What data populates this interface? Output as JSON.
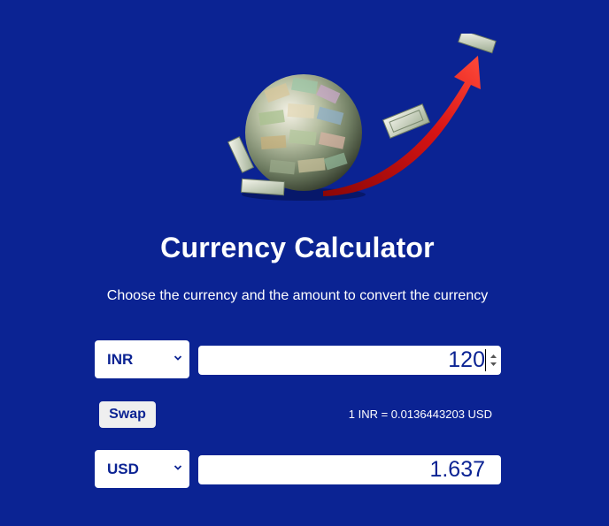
{
  "page": {
    "title": "Currency Calculator",
    "subtitle": "Choose the currency and the amount to convert the currency"
  },
  "converter": {
    "from_currency": "INR",
    "from_amount": "120",
    "swap_label": "Swap",
    "rate_text": "1 INR = 0.0136443203 USD",
    "to_currency": "USD",
    "to_amount": "1.637"
  },
  "icons": {
    "hero": "money-globe-growth-arrow-image",
    "select": "chevron-down-icon",
    "spinner": "number-spinner-icon"
  },
  "colors": {
    "background": "#0b2393",
    "text_on_background": "#ffffff",
    "field_text": "#0b2393",
    "arrow": "#d40f0f",
    "button_bg": "#efefef"
  }
}
